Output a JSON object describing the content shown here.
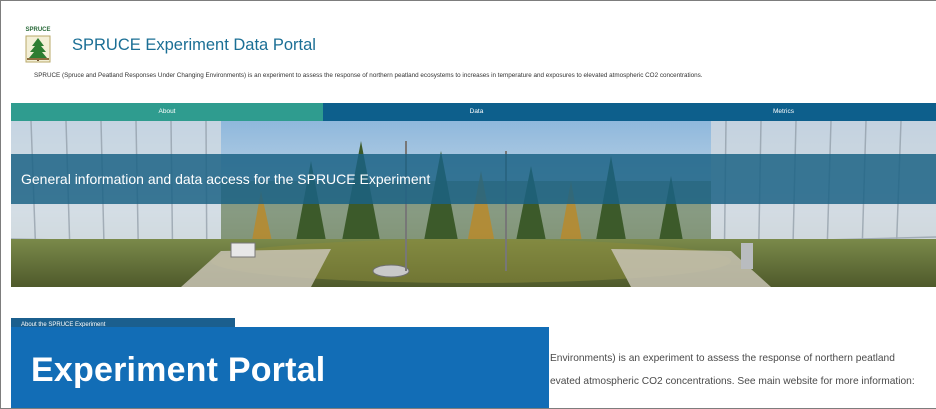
{
  "header": {
    "logo_text": "SPRUCE",
    "title": "SPRUCE Experiment Data Portal",
    "description": "SPRUCE (Spruce and Peatland Responses Under Changing Environments) is an experiment to assess the response of northern peatland ecosystems to increases in temperature and exposures to elevated atmospheric CO2 concentrations."
  },
  "nav": {
    "items": [
      {
        "label": "About",
        "active": true
      },
      {
        "label": "Data",
        "active": false
      },
      {
        "label": "Metrics",
        "active": false
      }
    ]
  },
  "hero": {
    "text": "General information and data access for the SPRUCE Experiment"
  },
  "sidebar": {
    "label": "About the SPRUCE Experiment"
  },
  "overlay": {
    "title": "Experiment Portal"
  },
  "intro": {
    "line1": "Environments) is an experiment to assess the response of northern peatland",
    "line2": "evated atmospheric CO2 concentrations. See main website for more information:"
  },
  "colors": {
    "title": "#1b6f95",
    "nav_bg": "#0d5f8c",
    "nav_active": "#2f9c8f",
    "overlay": "#126db6"
  }
}
